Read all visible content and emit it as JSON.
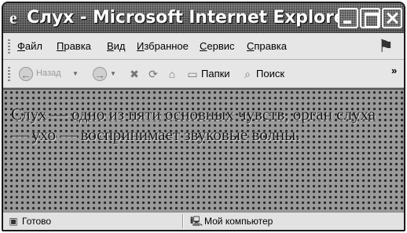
{
  "window": {
    "title": "Слух - Microsoft Internet Explorer",
    "title_icon": "ie-logo-icon"
  },
  "menu": {
    "items": [
      "Файл",
      "Правка",
      "Вид",
      "Избранное",
      "Сервис",
      "Справка"
    ]
  },
  "toolbar": {
    "back_label": "Назад",
    "folders_label": "Папки",
    "search_label": "Поиск",
    "overflow": "»"
  },
  "content": {
    "text": "Слух — одно из пяти основных чувств, орган слуха — ухо — воспринимает звуковые волны."
  },
  "status": {
    "left": "Готово",
    "zone": "Мой компьютер"
  },
  "colors": {
    "title_bg": "#7a7a7a",
    "content_bg": "#9a9a9a",
    "dots": "#2a2a2a"
  }
}
